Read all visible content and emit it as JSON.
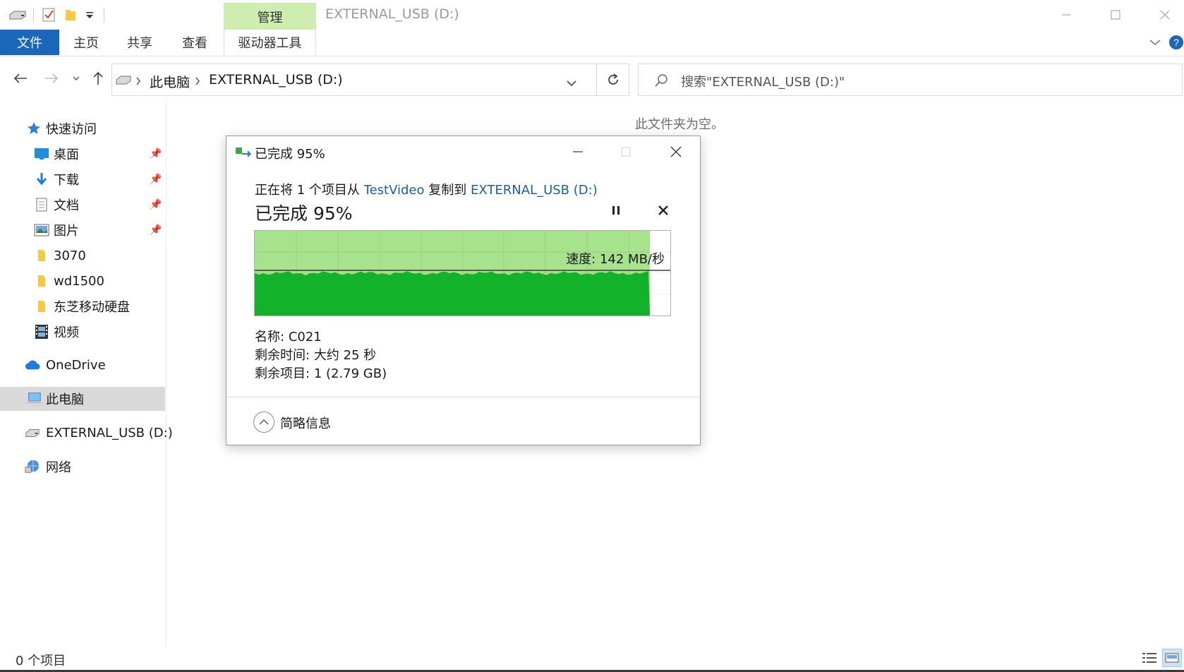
{
  "window": {
    "title": "EXTERNAL_USB (D:)",
    "contextual_tab": "管理"
  },
  "ribbon": {
    "tabs": [
      "文件",
      "主页",
      "共享",
      "查看",
      "驱动器工具"
    ]
  },
  "address": {
    "breadcrumb": [
      "此电脑",
      "EXTERNAL_USB (D:)"
    ],
    "search_placeholder": "搜索\"EXTERNAL_USB (D:)\""
  },
  "sidebar": {
    "quick_access": "快速访问",
    "pinned": [
      "桌面",
      "下载",
      "文档",
      "图片"
    ],
    "folders": [
      "3070",
      "wd1500",
      "东芝移动硬盘"
    ],
    "videos": "视频",
    "onedrive": "OneDrive",
    "this_pc": "此电脑",
    "external": "EXTERNAL_USB (D:)",
    "network": "网络"
  },
  "content": {
    "empty_message": "此文件夹为空。"
  },
  "status": {
    "item_count": "0 个项目"
  },
  "dialog": {
    "title": "已完成 95%",
    "copy_prefix": "正在将 1 个项目从",
    "source": "TestVideo",
    "copy_middle": "复制到",
    "destination": "EXTERNAL_USB (D:)",
    "status": "已完成 95%",
    "progress_percent": 95,
    "speed": "速度: 142 MB/秒",
    "name_label": "名称:",
    "name_value": "C021",
    "time_label": "剩余时间:",
    "time_value": "大约 25 秒",
    "items_label": "剩余项目:",
    "items_value": "1 (2.79 GB)",
    "details_toggle": "简略信息"
  },
  "colors": {
    "file_tab": "#1a66b8",
    "manage_tab": "#cdeeb0",
    "progress_light": "#a6e38c",
    "progress_dark": "#12b32a",
    "link": "#1b5fa8"
  }
}
